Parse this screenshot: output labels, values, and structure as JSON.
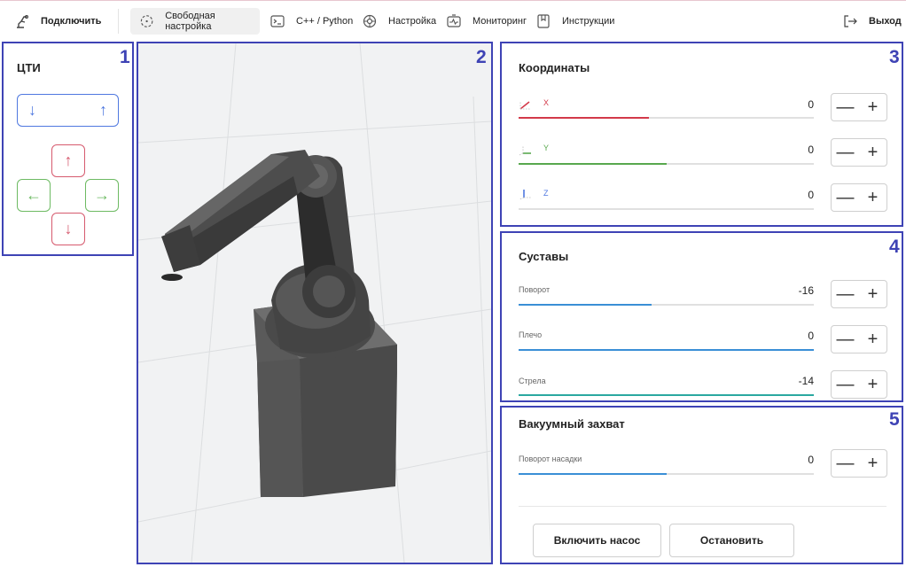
{
  "nav": {
    "connect": "Подключить",
    "free_setup": "Свободная настройка",
    "cpp_python": "C++ / Python",
    "settings": "Настройка",
    "monitoring": "Мониторинг",
    "instructions": "Инструкции",
    "logout": "Выход"
  },
  "panels": {
    "jog": {
      "number": "1",
      "title": "ЦТИ",
      "arrows": {
        "down": "↓",
        "up": "↑",
        "left": "←",
        "right": "→"
      }
    },
    "viewport": {
      "number": "2"
    },
    "coordinates": {
      "number": "3",
      "title": "Координаты",
      "rows": [
        {
          "label": "X",
          "value": "0",
          "level": 0.44,
          "color": "#d33a4a"
        },
        {
          "label": "Y",
          "value": "0",
          "level": 0.5,
          "color": "#58a84e"
        },
        {
          "label": "Z",
          "value": "0",
          "level": 0.0,
          "color": "#4f78e0"
        }
      ]
    },
    "joints": {
      "number": "4",
      "title": "Суставы",
      "rows": [
        {
          "label": "Поворот",
          "value": "-16",
          "level": 0.45,
          "color": "#3a8fd6"
        },
        {
          "label": "Плечо",
          "value": "0",
          "level": 1.0,
          "color": "#3a8fd6"
        },
        {
          "label": "Стрела",
          "value": "-14",
          "level": 1.0,
          "color": "#2aa8a0"
        }
      ]
    },
    "vacuum": {
      "number": "5",
      "title": "Вакуумный захват",
      "rows": [
        {
          "label": "Поворот насадки",
          "value": "0",
          "level": 0.5,
          "color": "#3a8fd6"
        }
      ],
      "pump_on": "Включить насос",
      "stop": "Остановить"
    }
  },
  "stepper": {
    "minus": "—",
    "plus": "+"
  }
}
